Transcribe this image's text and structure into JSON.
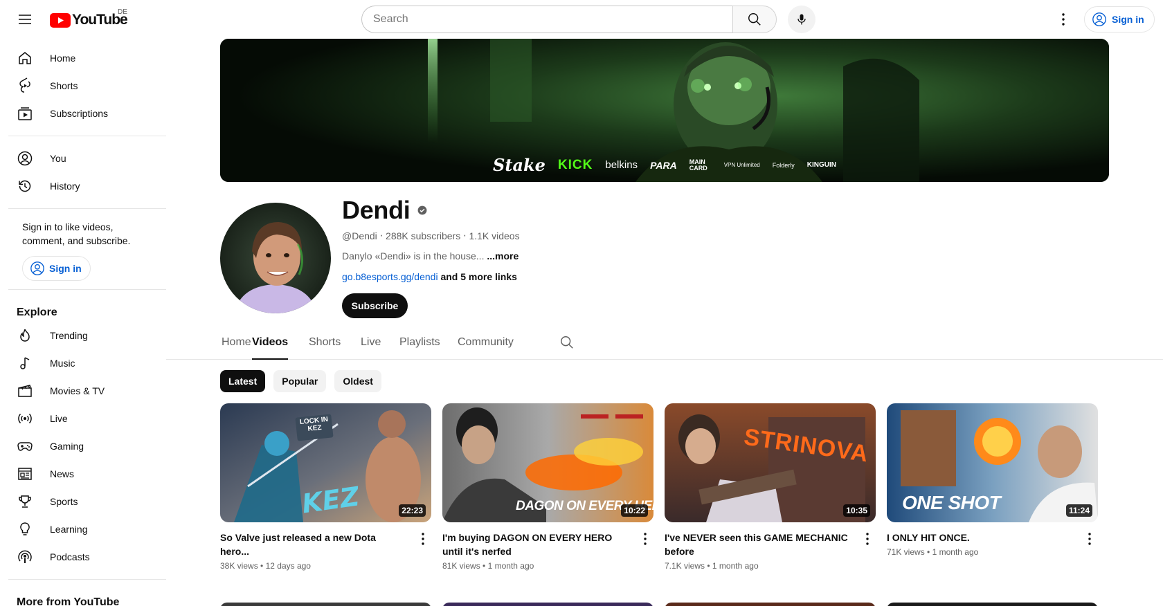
{
  "header": {
    "logo_text": "YouTube",
    "region": "DE",
    "search_placeholder": "Search",
    "signin_label": "Sign in"
  },
  "sidebar": {
    "main": [
      {
        "label": "Home",
        "icon": "home-icon"
      },
      {
        "label": "Shorts",
        "icon": "shorts-icon"
      },
      {
        "label": "Subscriptions",
        "icon": "subscriptions-icon"
      }
    ],
    "you": [
      {
        "label": "You",
        "icon": "account-icon"
      },
      {
        "label": "History",
        "icon": "history-icon"
      }
    ],
    "signin_hint": "Sign in to like videos, comment, and subscribe.",
    "signin_label": "Sign in",
    "explore_title": "Explore",
    "explore": [
      {
        "label": "Trending",
        "icon": "trending-icon"
      },
      {
        "label": "Music",
        "icon": "music-icon"
      },
      {
        "label": "Movies & TV",
        "icon": "movies-icon"
      },
      {
        "label": "Live",
        "icon": "live-icon"
      },
      {
        "label": "Gaming",
        "icon": "gaming-icon"
      },
      {
        "label": "News",
        "icon": "news-icon"
      },
      {
        "label": "Sports",
        "icon": "sports-icon"
      },
      {
        "label": "Learning",
        "icon": "learning-icon"
      },
      {
        "label": "Podcasts",
        "icon": "podcasts-icon"
      }
    ],
    "more_title": "More from YouTube"
  },
  "banner": {
    "sponsors": [
      "Stake",
      "KICK",
      "belkins",
      "PARA",
      "MAIN CARD",
      "VPN Unlimited",
      "Folderly",
      "KINGUIN"
    ]
  },
  "channel": {
    "name": "Dendi",
    "handle": "@Dendi",
    "subscribers": "288K subscribers",
    "videos_count": "1.1K videos",
    "description": "Danylo «Dendi» is in the house...",
    "more_label": "...more",
    "link": "go.b8esports.gg/dendi",
    "more_links": "and 5 more links",
    "subscribe_label": "Subscribe"
  },
  "tabs": [
    {
      "label": "Home",
      "active": false
    },
    {
      "label": "Videos",
      "active": true
    },
    {
      "label": "Shorts",
      "active": false
    },
    {
      "label": "Live",
      "active": false
    },
    {
      "label": "Playlists",
      "active": false
    },
    {
      "label": "Community",
      "active": false
    }
  ],
  "chips": [
    {
      "label": "Latest",
      "active": true
    },
    {
      "label": "Popular",
      "active": false
    },
    {
      "label": "Oldest",
      "active": false
    }
  ],
  "videos": [
    {
      "title": "So Valve just released a new Dota hero...",
      "views": "38K views",
      "age": "12 days ago",
      "duration": "22:23",
      "thumb_text": "KEZ",
      "thumb_badge": "LOCK IN KEZ"
    },
    {
      "title": "I'm buying DAGON ON EVERY HERO until it's nerfed",
      "views": "81K views",
      "age": "1 month ago",
      "duration": "10:22",
      "thumb_text": "DAGON ON EVERY HERO"
    },
    {
      "title": "I've NEVER seen this GAME MECHANIC before",
      "views": "7.1K views",
      "age": "1 month ago",
      "duration": "10:35",
      "thumb_text": "STRINOVA"
    },
    {
      "title": "I ONLY HIT ONCE.",
      "views": "71K views",
      "age": "1 month ago",
      "duration": "11:24",
      "thumb_text": "ONE SHOT"
    }
  ],
  "colors": {
    "accent": "#065fd4",
    "brand_red": "#ff0000",
    "text": "#0f0f0f",
    "muted": "#606060"
  }
}
